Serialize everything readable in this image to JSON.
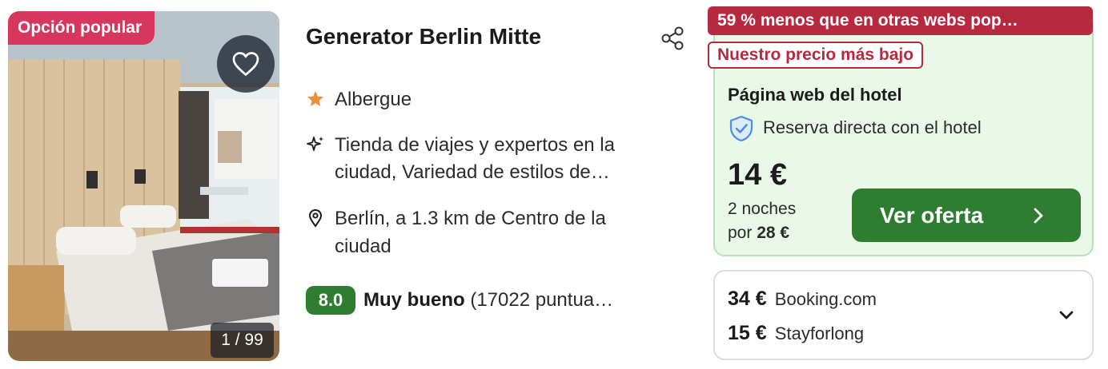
{
  "listing": {
    "badge": "Opción popular",
    "photo_counter": "1 / 99",
    "name": "Generator Berlin Mitte",
    "type": "Albergue",
    "features": [
      "Tienda de viajes y expertos en la",
      "ciudad, Variedad de estilos de…"
    ],
    "location": [
      "Berlín, a 1.3 km de Centro de la",
      "ciudad"
    ],
    "rating": {
      "score": "8.0",
      "label": "Muy bueno",
      "count_text": "(17022 puntua…"
    }
  },
  "deal": {
    "savings_text": "59 % menos que en otras webs pop…",
    "lowest_price_text": "Nuestro precio más bajo",
    "provider": "Página web del hotel",
    "direct_text": "Reserva directa con el hotel",
    "price": "14 €",
    "nights_text": "2 noches",
    "total_prefix": "por",
    "total": "28 €",
    "cta_label": "Ver oferta"
  },
  "other_offers": [
    {
      "price": "34 €",
      "provider": "Booking.com"
    },
    {
      "price": "15 €",
      "provider": "Stayforlong"
    }
  ],
  "colors": {
    "popular_badge": "#d7375c",
    "savings_badge": "#b7293f",
    "rating_green": "#2f7d31",
    "cta_green": "#2f7d31",
    "offer_bg": "#eaf8ea",
    "star": "#e8913a"
  },
  "icons": {
    "favorite": "heart-icon",
    "share": "share-icon",
    "type": "star-icon",
    "features": "sparkle-icon",
    "location": "pin-icon",
    "direct": "shield-check-icon",
    "cta": "chevron-right-icon",
    "expand": "chevron-down-icon"
  }
}
